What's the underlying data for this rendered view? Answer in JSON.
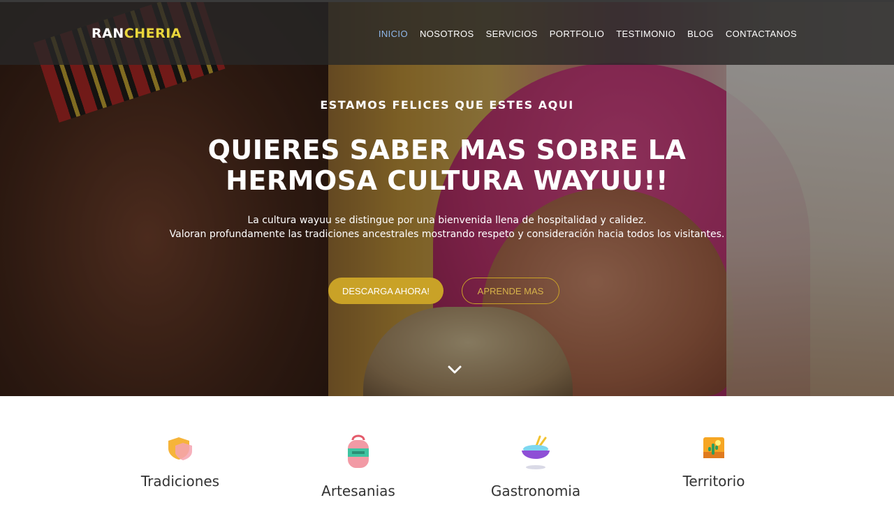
{
  "brand": {
    "part1": "RAN",
    "part2": "CHERIA"
  },
  "nav": {
    "items": [
      {
        "label": "INICIO",
        "active": true
      },
      {
        "label": "NOSOTROS"
      },
      {
        "label": "SERVICIOS"
      },
      {
        "label": "PORTFOLIO"
      },
      {
        "label": "TESTIMONIO"
      },
      {
        "label": "BLOG"
      },
      {
        "label": "CONTACTANOS"
      }
    ]
  },
  "hero": {
    "eyebrow": "ESTAMOS FELICES QUE ESTES AQUI",
    "headline": "QUIERES SABER MAS SOBRE LA HERMOSA CULTURA WAYUU!!",
    "lead_line1": "La cultura wayuu se distingue por una bienvenida llena de hospitalidad y calidez.",
    "lead_line2": "Valoran profundamente las tradiciones ancestrales mostrando respeto y consideración hacia todos los visitantes.",
    "primary_button": "DESCARGA AHORA!",
    "secondary_button": "APRENDE MAS",
    "scroll_icon": "chevron-down-icon"
  },
  "features": [
    {
      "title": "Tradiciones",
      "icon": "shield-icon"
    },
    {
      "title": "Artesanias",
      "icon": "bag-icon"
    },
    {
      "title": "Gastronomia",
      "icon": "bowl-icon"
    },
    {
      "title": "Territorio",
      "icon": "landscape-icon"
    }
  ],
  "colors": {
    "accent": "#c9a227",
    "brand_highlight": "#e9d63c",
    "nav_active": "#8fb7ea"
  }
}
